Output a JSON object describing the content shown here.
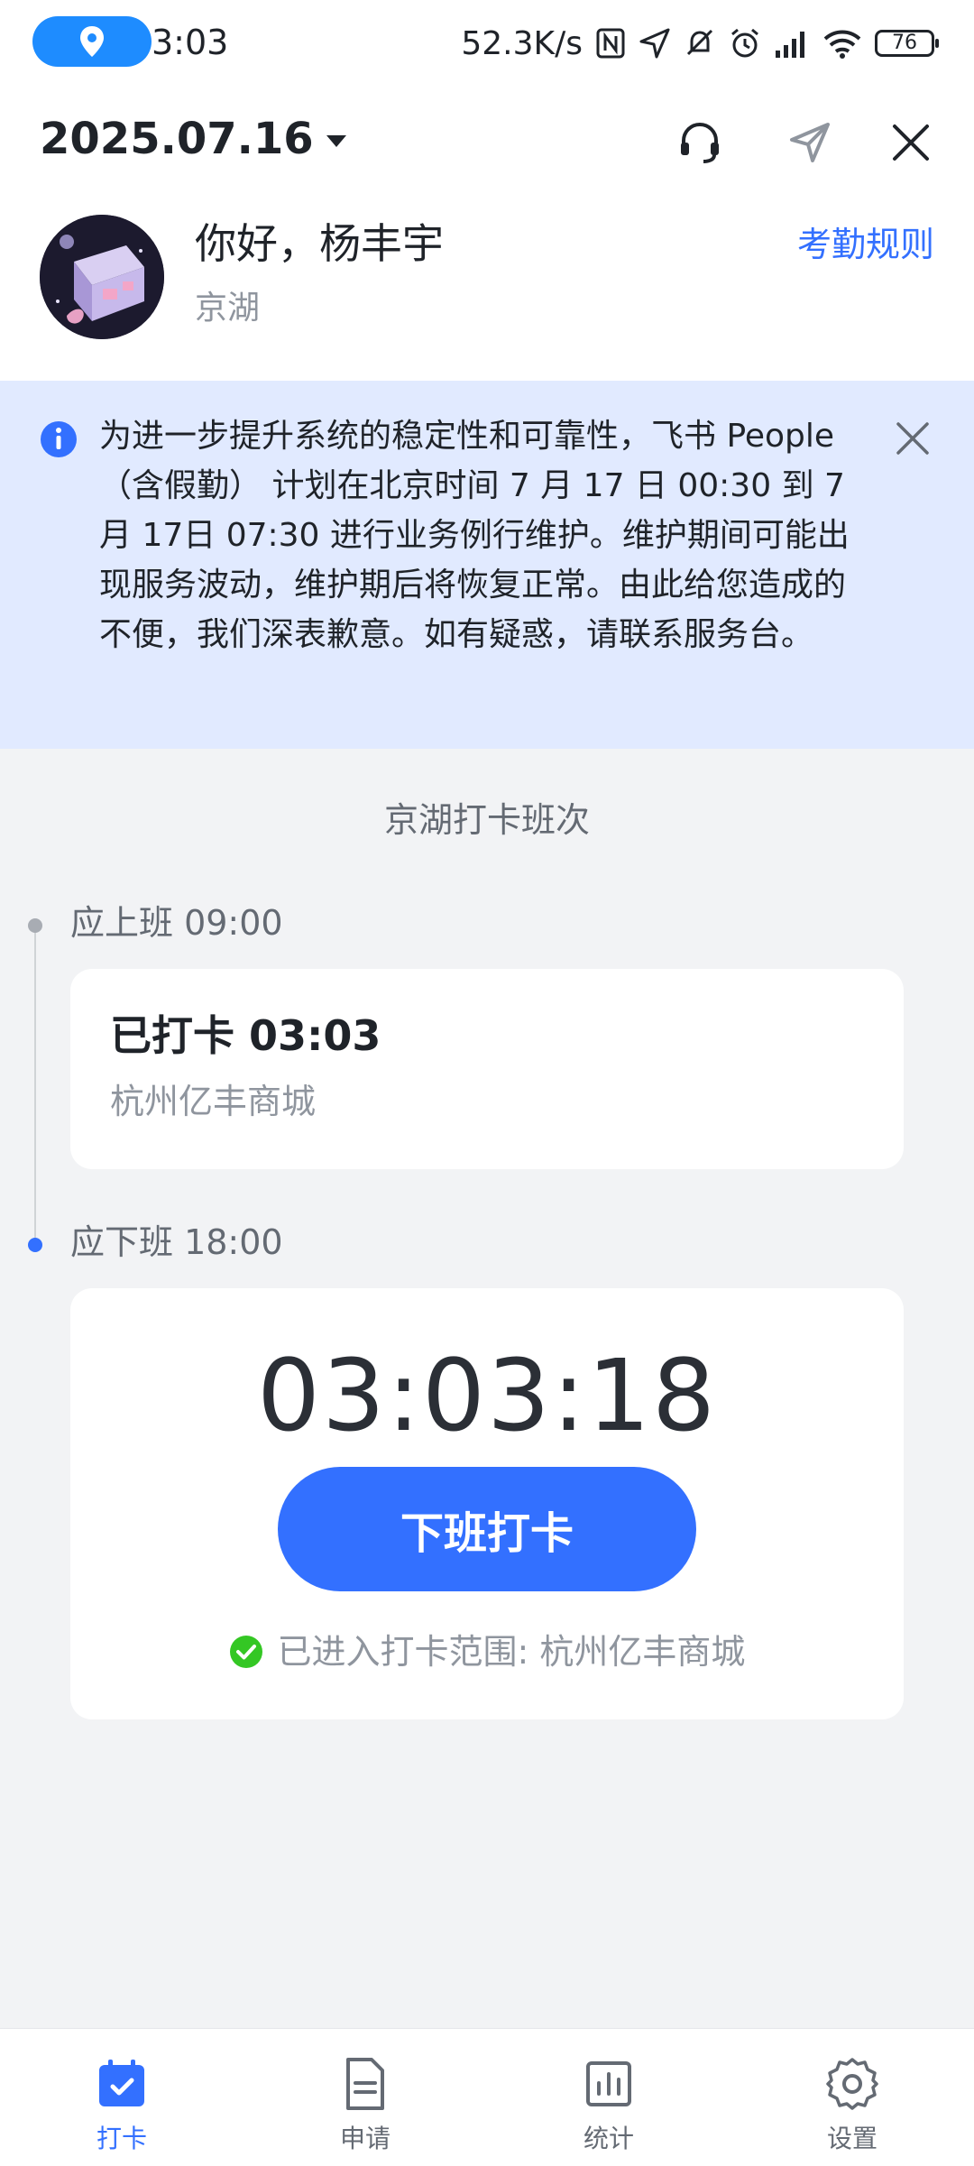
{
  "status_bar": {
    "time": "3:03",
    "net_speed": "52.3K/s",
    "battery": "76"
  },
  "header": {
    "date": "2025.07.16",
    "greeting": "你好，杨丰宇",
    "org": "京湖",
    "rules_link": "考勤规则"
  },
  "notice": {
    "text": "为进一步提升系统的稳定性和可靠性，飞书 People（含假勤） 计划在北京时间 7 月 17 日 00:30 到 7 月 17日 07:30 进行业务例行维护。维护期间可能出现服务波动，维护期后将恢复正常。由此给您造成的不便，我们深表歉意。如有疑惑，请联系服务台。"
  },
  "shift": {
    "title": "京湖打卡班次",
    "on_duty": {
      "label": "应上班 09:00",
      "status": "已打卡 03:03",
      "location": "杭州亿丰商城"
    },
    "off_duty": {
      "label": "应下班 18:00",
      "clock": "03:03:18",
      "button": "下班打卡",
      "range": "已进入打卡范围: 杭州亿丰商城"
    }
  },
  "tabs": [
    {
      "label": "打卡",
      "icon": "calendar-check-icon",
      "active": true
    },
    {
      "label": "申请",
      "icon": "document-icon",
      "active": false
    },
    {
      "label": "统计",
      "icon": "chart-icon",
      "active": false
    },
    {
      "label": "设置",
      "icon": "gear-icon",
      "active": false
    }
  ],
  "colors": {
    "accent": "#3370FF",
    "notice_bg": "#E1EAFF",
    "success": "#34C724",
    "location_pill": "#1E8CFF"
  }
}
